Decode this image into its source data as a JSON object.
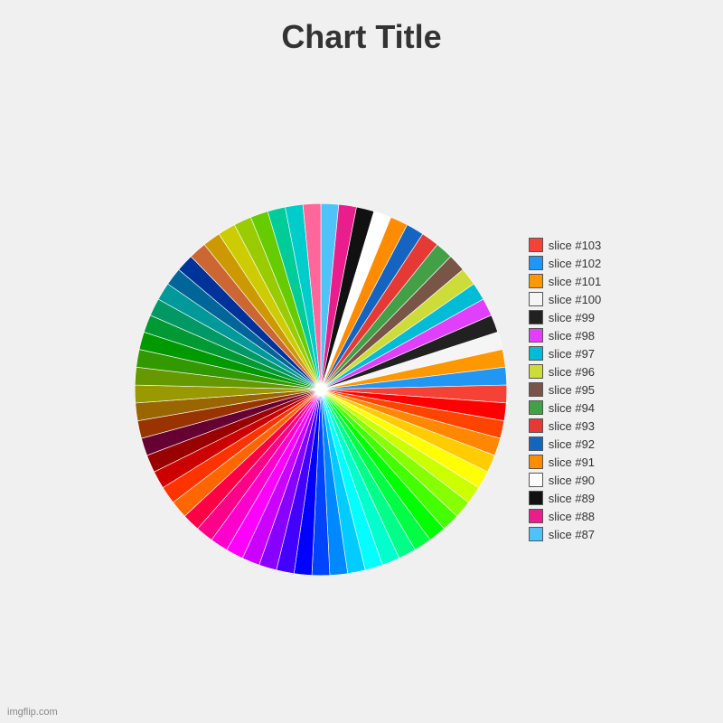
{
  "title": "Chart Title",
  "watermark": "imgflip.com",
  "slices": [
    {
      "label": "slice #87",
      "color": "#4fc3f7"
    },
    {
      "label": "slice #88",
      "color": "#e91e8c"
    },
    {
      "label": "slice #89",
      "color": "#111111"
    },
    {
      "label": "slice #90",
      "color": "#ffffff"
    },
    {
      "label": "slice #91",
      "color": "#ff8c00"
    },
    {
      "label": "slice #92",
      "color": "#1565c0"
    },
    {
      "label": "slice #93",
      "color": "#e53935"
    },
    {
      "label": "slice #94",
      "color": "#43a047"
    },
    {
      "label": "slice #95",
      "color": "#795548"
    },
    {
      "label": "slice #96",
      "color": "#cddc39"
    },
    {
      "label": "slice #97",
      "color": "#00bcd4"
    },
    {
      "label": "slice #98",
      "color": "#e040fb"
    },
    {
      "label": "slice #99",
      "color": "#212121"
    },
    {
      "label": "slice #100",
      "color": "#f5f5f5"
    },
    {
      "label": "slice #101",
      "color": "#ff9800"
    },
    {
      "label": "slice #102",
      "color": "#2196f3"
    },
    {
      "label": "slice #103",
      "color": "#f44336"
    }
  ],
  "extra_slice_colors": [
    "#ff0000",
    "#ff4400",
    "#ff8800",
    "#ffcc00",
    "#ffff00",
    "#ccff00",
    "#88ff00",
    "#44ff00",
    "#00ff00",
    "#00ff44",
    "#00ff88",
    "#00ffcc",
    "#00ffff",
    "#00ccff",
    "#0088ff",
    "#0044ff",
    "#0000ff",
    "#4400ff",
    "#8800ff",
    "#cc00ff",
    "#ff00ff",
    "#ff00cc",
    "#ff0088",
    "#ff0044",
    "#ff6600",
    "#ff3300",
    "#cc0000",
    "#990000",
    "#660000",
    "#993300",
    "#996600",
    "#999900",
    "#669900",
    "#339900",
    "#009900",
    "#009933",
    "#009966",
    "#009999",
    "#006699",
    "#003399",
    "#000099",
    "#330099",
    "#660099",
    "#990099",
    "#990066",
    "#990033",
    "#cc6600",
    "#cc9900",
    "#cccc00",
    "#99cc00",
    "#66cc00",
    "#33cc00",
    "#00cc00",
    "#00cc33",
    "#00cc66",
    "#00cc99",
    "#00cccc",
    "#00ccff",
    "#ff6699",
    "#ff99cc",
    "#ffccff",
    "#ccccff",
    "#99ccff",
    "#66ccff"
  ]
}
